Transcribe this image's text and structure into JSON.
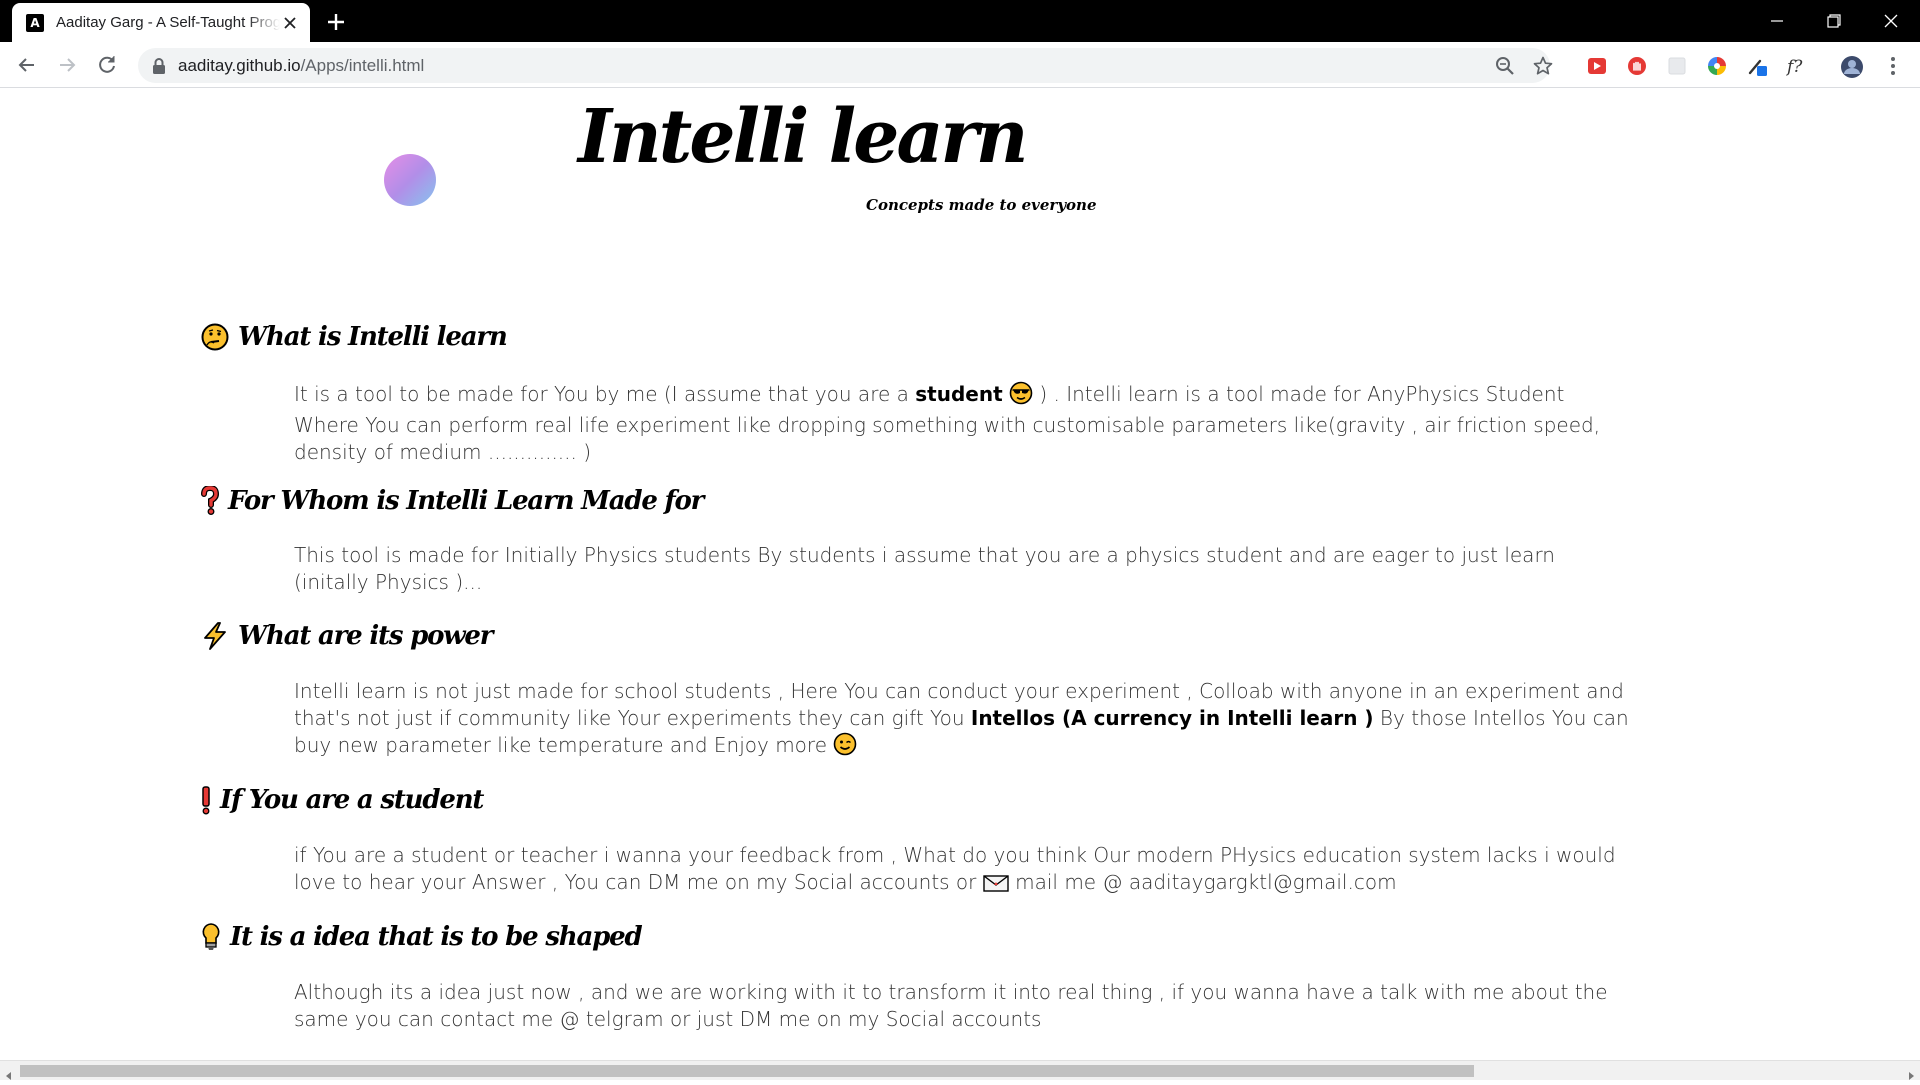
{
  "browser": {
    "tab_title": "Aaditay Garg - A Self-Taught Programmer",
    "tab_favicon_letter": "A",
    "url_host": "aaditay.github.io",
    "url_path": "/Apps/intelli.html"
  },
  "page": {
    "title": "Intelli learn",
    "subtitle": "Concepts made to everyone",
    "sections": [
      {
        "icon": "thinking-face-icon",
        "heading": "What is Intelli learn",
        "pre": "It is a tool to be made for You by me (I assume that you are a ",
        "bold": "student",
        "post": " ) . Intelli learn is a tool made for AnyPhysics Student Where You can perform real life experiment like dropping something with customisable parameters like(gravity , air friction speed, density of medium .............. )"
      },
      {
        "icon": "question-mark-icon",
        "heading": "For Whom is Intelli Learn Made for",
        "text": "This tool is made for Initially Physics students By students i assume that you are a physics student and are eager to just learn (initally Physics )..."
      },
      {
        "icon": "lightning-icon",
        "heading": "What are its power",
        "pre": "Intelli learn is not just made for school students , Here You can conduct your experiment , Colloab with anyone in an experiment and that's not just if community like Your experiments they can gift You ",
        "bold": "Intellos (A currency in Intelli learn )",
        "post": " By those Intellos You can buy new parameter like temperature and Enjoy more "
      },
      {
        "icon": "exclamation-mark-icon",
        "heading": "If You are a student",
        "pre": "if You are a student or teacher i wanna your feedback from , What do you think Our modern PHysics education system lacks i would love to hear your Answer , You can DM me on my Social accounts or ",
        "post": " mail me @ aaditaygargktl@gmail.com"
      },
      {
        "icon": "light-bulb-icon",
        "heading": "It is a idea that is to be shaped",
        "text": "Although its a idea just now , and we are working with it to transform it into real thing , if you wanna have a talk with me about the same you can contact me @ telgram or just DM me on my Social accounts"
      }
    ]
  }
}
